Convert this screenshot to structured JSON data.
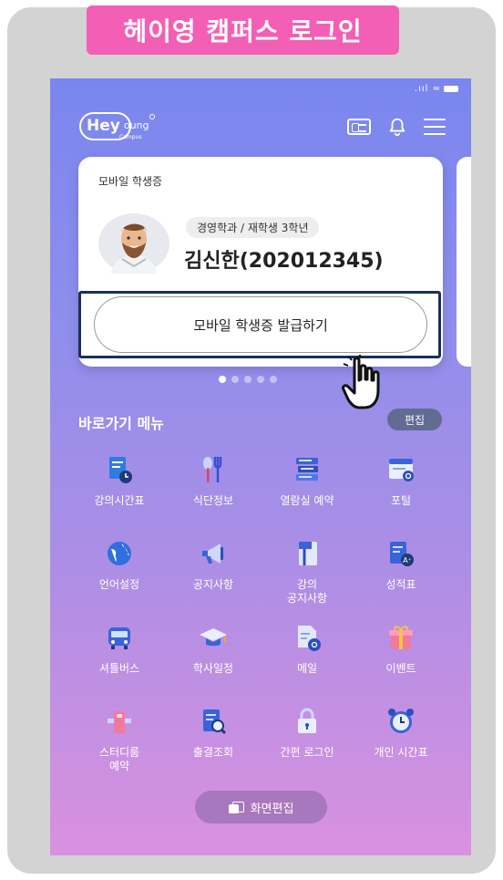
{
  "banner": {
    "title": "헤이영 캠퍼스 로그인"
  },
  "status_bar": {
    "signal": ".ııl"
  },
  "header": {
    "logo_main": "Hey",
    "logo_sub": "oung",
    "logo_caption": "Campus"
  },
  "student_card": {
    "label": "모바일 학생증",
    "department": "경영학과 / 재학생 3학년",
    "name": "김신한(202012345)",
    "issue_button_label": "모바일 학생증 발급하기"
  },
  "carousel": {
    "page_count": 5,
    "current_page": 1
  },
  "shortcuts": {
    "title": "바로가기 메뉴",
    "edit_label": "편집",
    "items": [
      {
        "label": "강의시간표",
        "icon": "timetable-icon"
      },
      {
        "label": "식단정보",
        "icon": "utensils-icon"
      },
      {
        "label": "열람실 예약",
        "icon": "books-icon"
      },
      {
        "label": "포털",
        "icon": "portal-icon"
      },
      {
        "label": "언어설정",
        "icon": "globe-icon"
      },
      {
        "label": "공지사항",
        "icon": "megaphone-icon"
      },
      {
        "label": "강의\n공지사항",
        "icon": "pin-note-icon"
      },
      {
        "label": "성적표",
        "icon": "grade-report-icon"
      },
      {
        "label": "셔틀버스",
        "icon": "bus-icon"
      },
      {
        "label": "학사일정",
        "icon": "graduation-cap-icon"
      },
      {
        "label": "메일",
        "icon": "mail-icon"
      },
      {
        "label": "이벤트",
        "icon": "gift-icon"
      },
      {
        "label": "스터디룸\n예약",
        "icon": "study-room-icon"
      },
      {
        "label": "출결조회",
        "icon": "attendance-search-icon"
      },
      {
        "label": "간편 로그인",
        "icon": "lock-icon"
      },
      {
        "label": "개인 시간표",
        "icon": "alarm-clock-icon"
      }
    ]
  },
  "footer": {
    "screen_edit_label": "화면편집"
  }
}
